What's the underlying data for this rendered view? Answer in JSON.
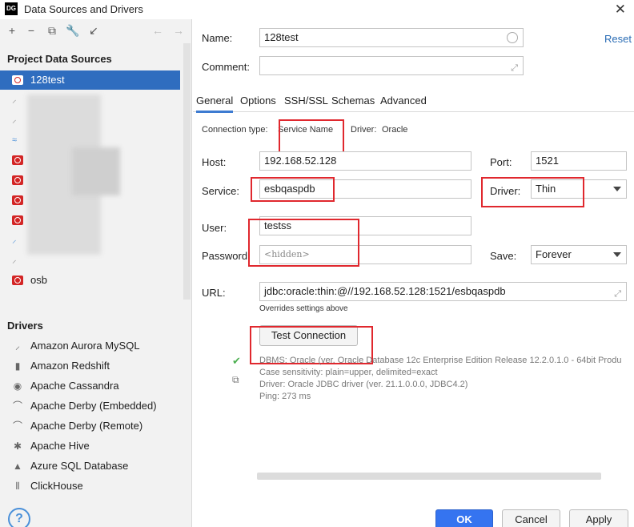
{
  "window": {
    "title": "Data Sources and Drivers",
    "app_badge": "DG"
  },
  "sidebar": {
    "project_title": "Project Data Sources",
    "datasources": [
      {
        "label": "128test",
        "icon": "oracle-icon",
        "selected": true
      },
      {
        "label": "",
        "icon": "feather-icon"
      },
      {
        "label": "",
        "icon": "feather-icon"
      },
      {
        "label": "",
        "icon": "mysql-icon"
      },
      {
        "label": "",
        "icon": "oracle-icon"
      },
      {
        "label": "",
        "icon": "oracle-icon"
      },
      {
        "label": "",
        "icon": "oracle-icon"
      },
      {
        "label": "",
        "icon": "oracle-icon"
      },
      {
        "label": "",
        "icon": "feather-icon"
      },
      {
        "label": "",
        "icon": "feather-icon"
      },
      {
        "label": "osb",
        "icon": "oracle-icon"
      }
    ],
    "drivers_title": "Drivers",
    "drivers": [
      {
        "label": "Amazon Aurora MySQL",
        "icon": "aurora-icon"
      },
      {
        "label": "Amazon Redshift",
        "icon": "redshift-icon"
      },
      {
        "label": "Apache Cassandra",
        "icon": "cassandra-icon"
      },
      {
        "label": "Apache Derby (Embedded)",
        "icon": "derby-icon"
      },
      {
        "label": "Apache Derby (Remote)",
        "icon": "derby-icon"
      },
      {
        "label": "Apache Hive",
        "icon": "hive-icon"
      },
      {
        "label": "Azure SQL Database",
        "icon": "azure-icon"
      },
      {
        "label": "ClickHouse",
        "icon": "clickhouse-icon"
      }
    ]
  },
  "form": {
    "name_label": "Name:",
    "name_value": "128test",
    "reset_label": "Reset",
    "comment_label": "Comment:",
    "comment_value": "",
    "tabs": [
      "General",
      "Options",
      "SSH/SSL",
      "Schemas",
      "Advanced"
    ],
    "connection_type_label": "Connection type:",
    "connection_type_value": "Service Name",
    "driver_link_label": "Driver:",
    "driver_link_value": "Oracle",
    "host_label": "Host:",
    "host_value": "192.168.52.128",
    "port_label": "Port:",
    "port_value": "1521",
    "service_label": "Service:",
    "service_value": "esbqaspdb",
    "driver_label": "Driver:",
    "driver_value": "Thin",
    "user_label": "User:",
    "user_value": "testss",
    "password_label": "Password:",
    "password_value": "<hidden>",
    "save_label": "Save:",
    "save_value": "Forever",
    "url_label": "URL:",
    "url_value": "jdbc:oracle:thin:@//192.168.52.128:1521/esbqaspdb",
    "overrides_note": "Overrides settings above",
    "test_connection_label": "Test Connection",
    "result_lines": [
      "DBMS: Oracle (ver. Oracle Database 12c Enterprise Edition Release 12.2.0.1.0 - 64bit Produ",
      "Case sensitivity: plain=upper, delimited=exact",
      "Driver: Oracle JDBC driver (ver. 21.1.0.0.0, JDBC4.2)",
      "Ping: 273 ms"
    ]
  },
  "footer": {
    "help_label": "?",
    "ok_label": "OK",
    "cancel_label": "Cancel",
    "apply_label": "Apply"
  },
  "colors": {
    "accent": "#2f6dbf",
    "annotation": "#e0282e",
    "link": "#2b6db5",
    "oracle": "#d32525"
  }
}
